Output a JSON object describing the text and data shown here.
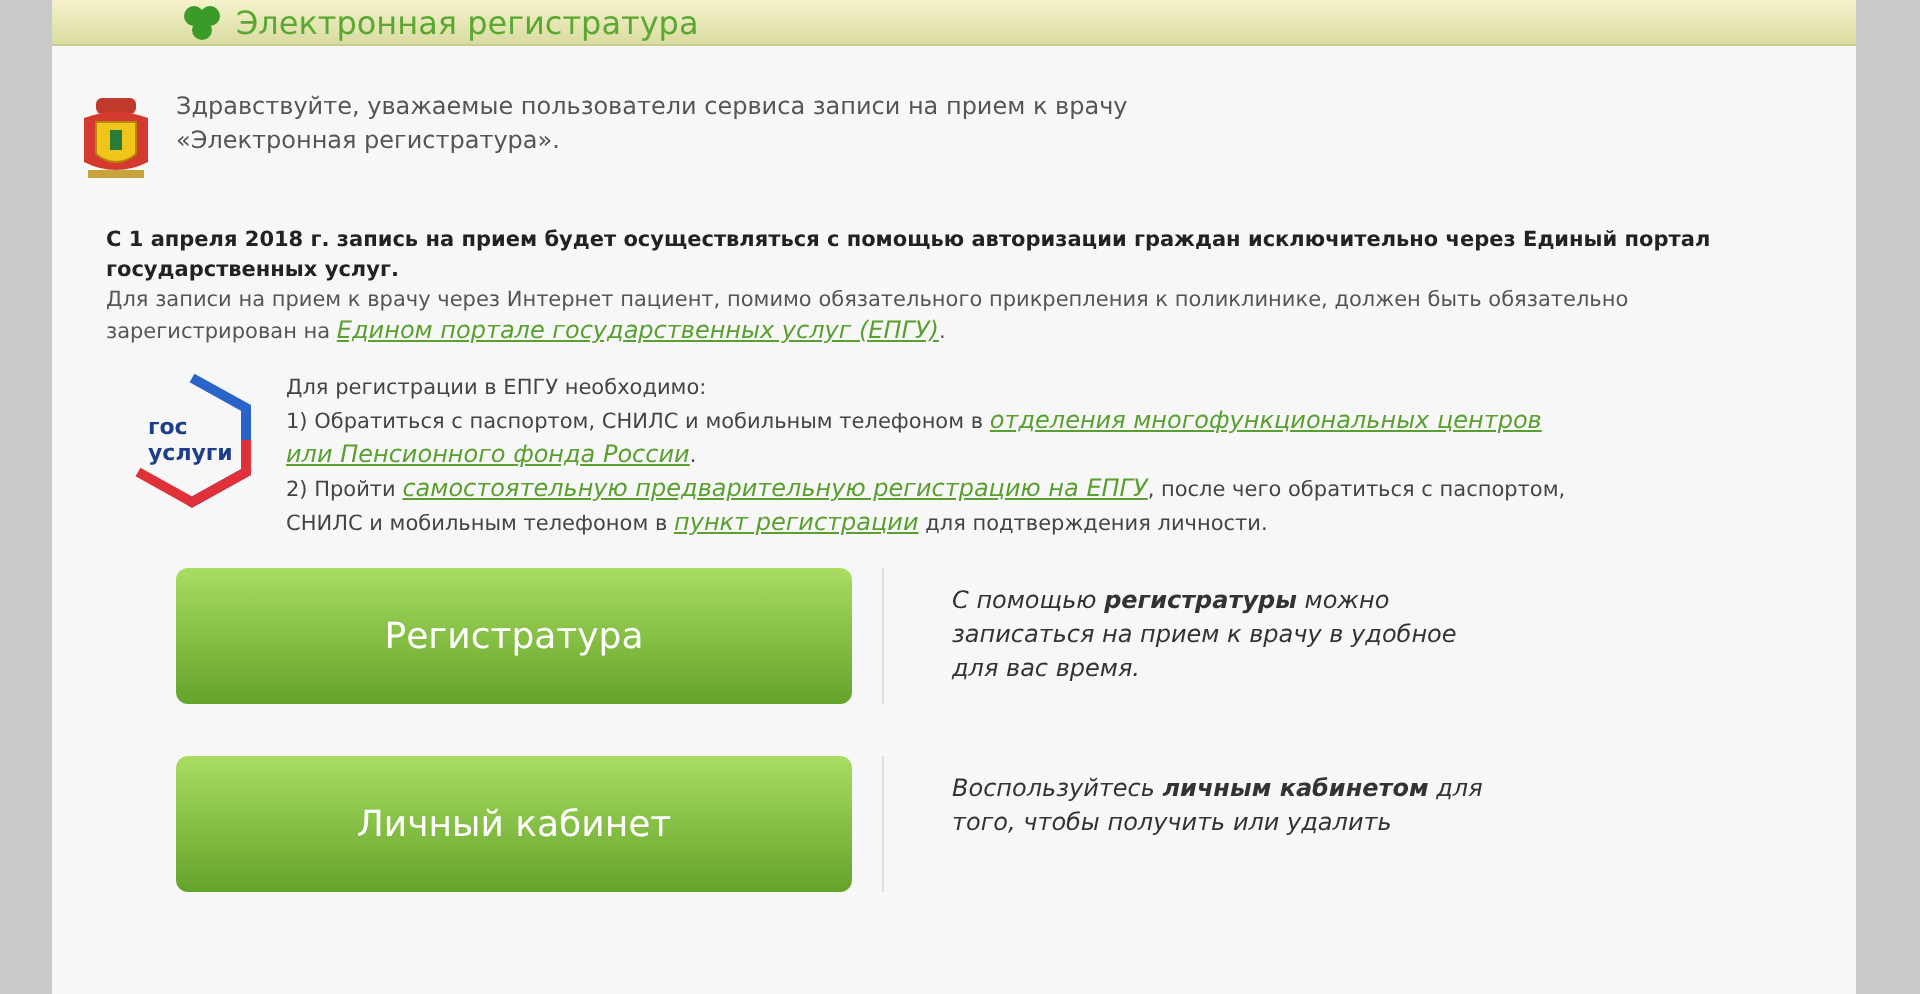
{
  "header": {
    "title": "Электронная регистратура"
  },
  "greeting": "Здравствуйте, уважаемые пользователи сервиса записи на прием к врачу «Электронная регистратура».",
  "notice": {
    "bold": "С 1 апреля 2018 г. запись на прием будет осуществляться с помощью авторизации граждан исключительно через Единый портал государственных услуг.",
    "parts": [
      {
        "kind": "text",
        "text": "Для записи на прием к врачу через Интернет пациент, помимо обязательного прикрепления к поликлинике, должен быть обязательно зарегистрирован на "
      },
      {
        "kind": "link",
        "text": "Едином портале государственных услуг (ЕПГУ)"
      },
      {
        "kind": "text",
        "text": "."
      }
    ]
  },
  "epgu": {
    "logo": [
      "гос",
      "услуги"
    ],
    "intro": "Для регистрации в ЕПГУ необходимо:",
    "steps": [
      [
        {
          "kind": "text",
          "text": "1) Обратиться с паспортом, СНИЛС и мобильным телефоном в "
        },
        {
          "kind": "link",
          "text": "отделения многофункциональных центров"
        },
        {
          "kind": "link",
          "text": "или Пенсионного фонда России"
        },
        {
          "kind": "text",
          "text": "."
        }
      ],
      [
        {
          "kind": "text",
          "text": "2) Пройти "
        },
        {
          "kind": "link",
          "text": "самостоятельную предварительную регистрацию на ЕПГУ"
        },
        {
          "kind": "text",
          "text": ", после чего обратиться с паспортом, СНИЛС и мобильным телефоном в "
        },
        {
          "kind": "link",
          "text": "пункт регистрации"
        },
        {
          "kind": "text",
          "text": " для подтверждения личности."
        }
      ]
    ]
  },
  "actions": [
    {
      "label": "Регистратура",
      "description": "С помощью **регистратуры** можно записаться на прием к врачу в удобное для вас время."
    },
    {
      "label": "Личный кабинет",
      "description": "Воспользуйтесь **личным кабинетом** для того, чтобы получить или удалить"
    }
  ]
}
